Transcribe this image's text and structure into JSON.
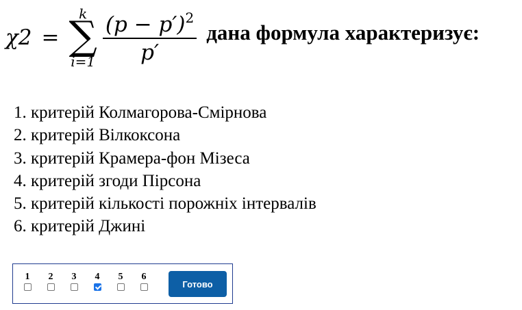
{
  "question": {
    "formula": {
      "lhs": "χ2",
      "equals": "=",
      "sum_upper": "k",
      "sum_symbol": "∑",
      "sum_lower": "i=1",
      "numerator_base": "(p − p′)",
      "numerator_exponent": "2",
      "denominator": "p′"
    },
    "text": "дана формула характеризує:"
  },
  "options": [
    "1. критерій Колмагорова-Смірнова",
    "2. критерій Вілкоксона",
    "3. критерій Крамера-фон Мізеса",
    "4. критерій згоди Пірсона",
    "5. критерій кількості порожніх інтервалів",
    "6. критерій Джині"
  ],
  "answer_panel": {
    "choices": [
      {
        "label": "1",
        "checked": false
      },
      {
        "label": "2",
        "checked": false
      },
      {
        "label": "3",
        "checked": false
      },
      {
        "label": "4",
        "checked": true
      },
      {
        "label": "5",
        "checked": false
      },
      {
        "label": "6",
        "checked": false
      }
    ],
    "submit_label": "Готово",
    "colors": {
      "border": "#1f3b8f",
      "button": "#0d5fa6",
      "checkbox_checked": "#1a73e8"
    }
  }
}
